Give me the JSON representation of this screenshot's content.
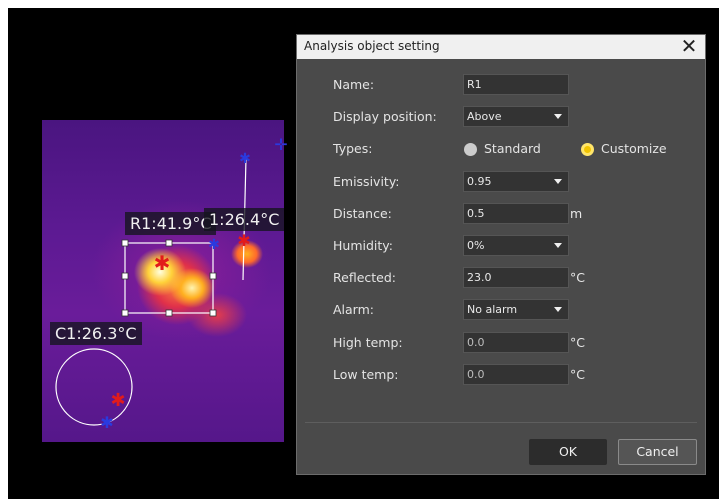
{
  "thermal_view": {
    "labels": {
      "r1": "R1:41.9°C",
      "l1": "1:26.4°C",
      "c1": "C1:26.3°C"
    }
  },
  "dialog": {
    "title": "Analysis object setting",
    "close_icon": "close-icon",
    "fields": {
      "name": {
        "label": "Name:",
        "value": "R1"
      },
      "display_position": {
        "label": "Display position:",
        "value": "Above"
      },
      "types": {
        "label": "Types:",
        "options": [
          "Standard",
          "Customize"
        ],
        "selected": "Customize"
      },
      "emissivity": {
        "label": "Emissivity:",
        "value": "0.95"
      },
      "distance": {
        "label": "Distance:",
        "value": "0.5",
        "unit": "m"
      },
      "humidity": {
        "label": "Humidity:",
        "value": "0%"
      },
      "reflected": {
        "label": "Reflected:",
        "value": "23.0",
        "unit": "°C"
      },
      "alarm": {
        "label": "Alarm:",
        "value": "No alarm"
      },
      "high_temp": {
        "label": "High temp:",
        "value": "0.0",
        "unit": "°C"
      },
      "low_temp": {
        "label": "Low temp:",
        "value": "0.0",
        "unit": "°C"
      }
    },
    "buttons": {
      "ok": "OK",
      "cancel": "Cancel"
    },
    "colors": {
      "accent_radio": "#f2c400",
      "dialog_bg": "#4a4a4a"
    }
  }
}
